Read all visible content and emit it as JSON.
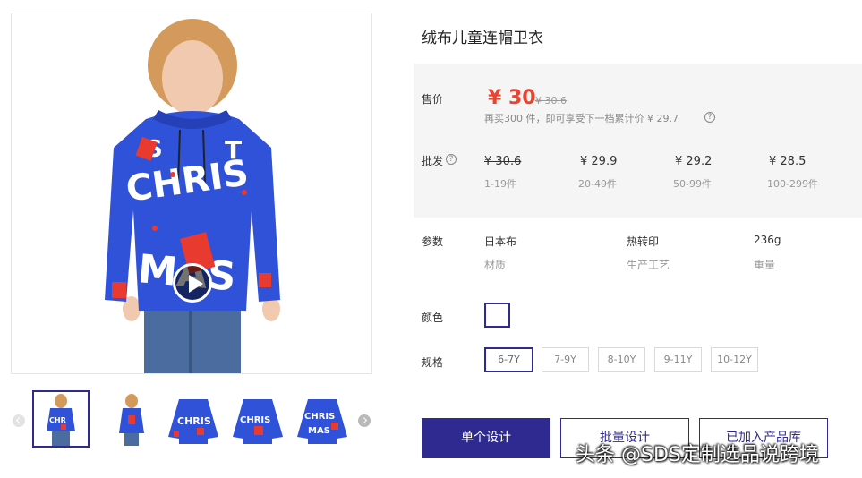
{
  "product": {
    "title": "绒布儿童连帽卫衣"
  },
  "price": {
    "label": "售价",
    "current": "¥ 30",
    "original": "¥ 30.6",
    "note": "再买300 件，即可享受下一档累计价 ¥ 29.7",
    "help_icon": "question-circle-icon"
  },
  "wholesale": {
    "label": "批发",
    "tiers": [
      {
        "price": "¥ 30.6",
        "qty": "1-19件",
        "strikethrough": true
      },
      {
        "price": "¥ 29.9",
        "qty": "20-49件",
        "strikethrough": false
      },
      {
        "price": "¥ 29.2",
        "qty": "50-99件",
        "strikethrough": false
      },
      {
        "price": "¥ 28.5",
        "qty": "100-299件",
        "strikethrough": false
      }
    ]
  },
  "params": {
    "label": "参数",
    "items": [
      {
        "value": "日本布",
        "name": "材质"
      },
      {
        "value": "热转印",
        "name": "生产工艺"
      },
      {
        "value": "236g",
        "name": "重量"
      }
    ]
  },
  "color": {
    "label": "颜色",
    "selected_swatch": "#ffffff"
  },
  "size": {
    "label": "规格",
    "options": [
      "6-7Y",
      "7-9Y",
      "8-10Y",
      "9-11Y",
      "10-12Y"
    ],
    "selected": "6-7Y"
  },
  "actions": {
    "single_design": "单个设计",
    "batch_design": "批量设计",
    "added_to_library": "已加入产品库"
  },
  "gallery": {
    "thumbnail_count": 5,
    "active_index": 0,
    "play_icon": "play-icon"
  },
  "watermark": "头条 @SDS定制选品说跨境",
  "colors": {
    "accent": "#2f2a8f",
    "price": "#e8442f",
    "hoodie_blue": "#2f52d9",
    "panel_bg": "#f5f5f5"
  }
}
